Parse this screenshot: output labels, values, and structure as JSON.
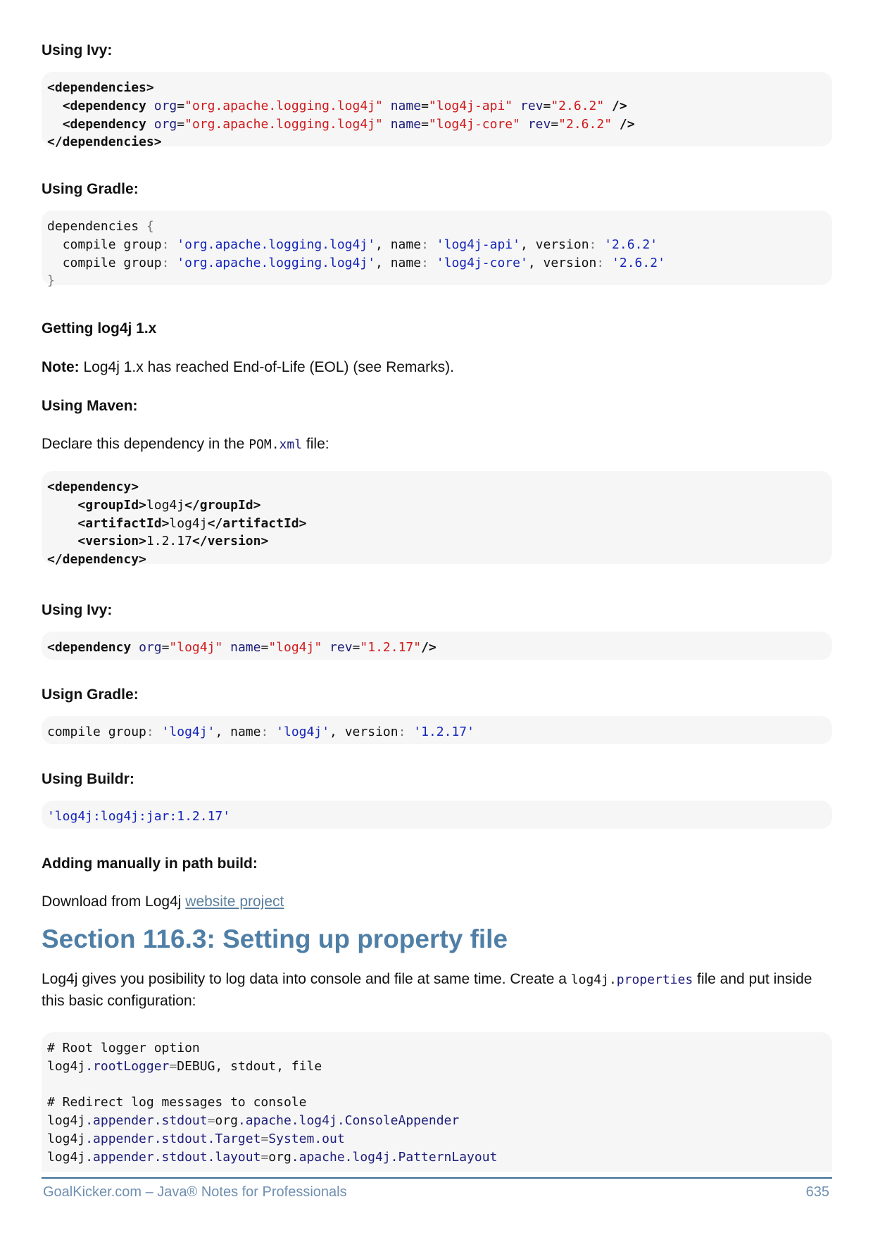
{
  "ivy2_heading": "Using Ivy:",
  "ivy2_code": {
    "open": "<dependencies>",
    "dep_tag": "<dependency",
    "org_attr": "org",
    "org_val": "\"org.apache.logging.log4j\"",
    "name_attr": "name",
    "name_api": "\"log4j-api\"",
    "name_core": "\"log4j-core\"",
    "rev_attr": "rev",
    "rev_val": "\"2.6.2\"",
    "self_close": "/>",
    "close": "</dependencies>"
  },
  "gradle2_heading": "Using Gradle:",
  "gradle2_code": {
    "kw_dependencies": "dependencies",
    "open_brace": "{",
    "compile": "compile",
    "group": "group",
    "group_val": "'org.apache.logging.log4j'",
    "name": "name",
    "name_api": "'log4j-api'",
    "name_core": "'log4j-core'",
    "version": "version",
    "version_val": "'2.6.2'",
    "close_brace": "}"
  },
  "getting1x_heading": "Getting log4j 1.x",
  "note_label": "Note:",
  "note_text": " Log4j 1.x has reached End-of-Life (EOL) (see Remarks).",
  "maven_heading": "Using Maven:",
  "declare_text_before": "Declare this dependency in the ",
  "declare_code_a": "POM.",
  "declare_code_b": "xml",
  "declare_text_after": " file:",
  "maven_code": {
    "open": "<dependency>",
    "groupId_open": "<groupId>",
    "groupId_val": "log4j",
    "groupId_close": "</groupId>",
    "artifactId_open": "<artifactId>",
    "artifactId_val": "log4j",
    "artifactId_close": "</artifactId>",
    "version_open": "<version>",
    "version_val": "1.2.17",
    "version_close": "</version>",
    "close": "</dependency>"
  },
  "ivy1_heading": "Using Ivy:",
  "ivy1_code": {
    "tag": "<dependency",
    "org_attr": "org",
    "org_val": "\"log4j\"",
    "name_attr": "name",
    "name_val": "\"log4j\"",
    "rev_attr": "rev",
    "rev_val": "\"1.2.17\"",
    "end": "/>"
  },
  "gradle1_heading": "Usign Gradle:",
  "gradle1_code": {
    "compile": "compile",
    "group": "group",
    "group_val": "'log4j'",
    "name": "name",
    "name_val": "'log4j'",
    "version": "version",
    "version_val": "'1.2.17'"
  },
  "buildr_heading": "Using Buildr:",
  "buildr_code": "'log4j:log4j:jar:1.2.17'",
  "manual_heading": "Adding manually in path build:",
  "download_text": "Download from Log4j ",
  "download_link": "website project",
  "section_title": "Section 116.3: Setting up property file",
  "props_intro_before": "Log4j gives you posibility to log data into console and file at same time. Create a ",
  "props_code_a": "log4j.",
  "props_code_b": "properties",
  "props_intro_after": " file and put inside this basic configuration:",
  "props_code": {
    "c1": "# Root logger option",
    "l1_a": "log4j",
    "l1_b": ".rootLogger",
    "l1_c": "=",
    "l1_d": "DEBUG, stdout, file",
    "c2": "# Redirect log messages to console",
    "l2_a": "log4j",
    "l2_b": ".appender.stdout",
    "l2_c": "=",
    "l2_d": "org",
    "l2_e": ".apache.log4j.ConsoleAppender",
    "l3_a": "log4j",
    "l3_b": ".appender.stdout.Target",
    "l3_c": "=",
    "l3_d": "System",
    "l3_e": ".out",
    "l4_a": "log4j",
    "l4_b": ".appender.stdout.layout",
    "l4_c": "=",
    "l4_d": "org",
    "l4_e": ".apache.log4j.PatternLayout"
  },
  "footer_left": "GoalKicker.com – Java® Notes for Professionals",
  "footer_right": "635"
}
